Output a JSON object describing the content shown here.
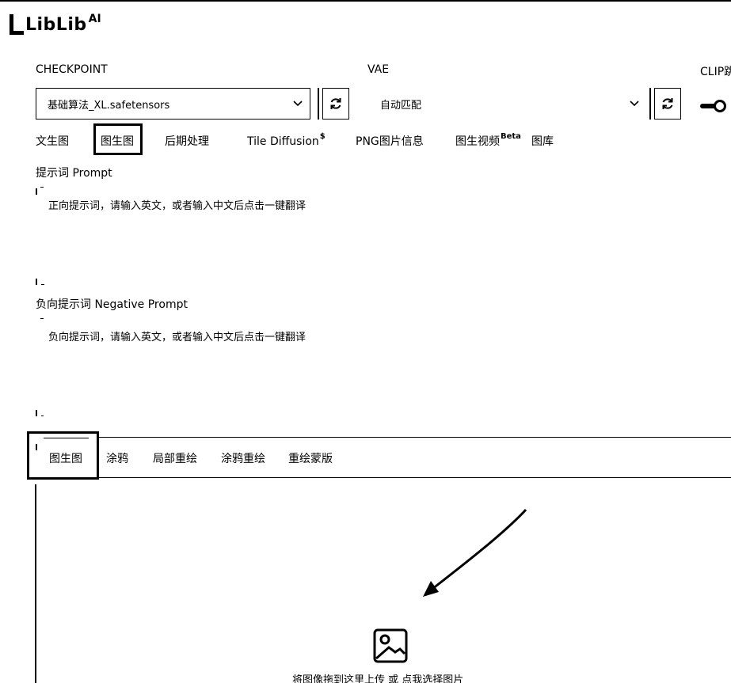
{
  "logo": {
    "text": "LibLib",
    "sup": "AI"
  },
  "checkpoint": {
    "label": "CHECKPOINT",
    "value": "基础算法_XL.safetensors"
  },
  "vae": {
    "label": "VAE",
    "value": "自动匹配"
  },
  "clip": {
    "label": "CLIP跳"
  },
  "icons": {
    "refresh": "refresh-icon",
    "chevron": "chevron-down-icon",
    "upload": "image-upload-icon"
  },
  "main_tabs": [
    {
      "label": "文生图"
    },
    {
      "label": "图生图",
      "active": true
    },
    {
      "label": "后期处理"
    },
    {
      "label": "Tile Diffusion",
      "sup": "$"
    },
    {
      "label": "PNG图片信息"
    },
    {
      "label": "图生视频",
      "sup": "Beta"
    },
    {
      "label": "图库"
    }
  ],
  "prompt": {
    "label": "提示词  Prompt",
    "placeholder": "正向提示词，请输入英文，或者输入中文后点击一键翻译"
  },
  "negative_prompt": {
    "label": "负向提示词  Negative Prompt",
    "placeholder": "负向提示词，请输入英文，或者输入中文后点击一键翻译"
  },
  "sub_tabs": [
    {
      "label": "图生图",
      "active": true
    },
    {
      "label": "涂鸦"
    },
    {
      "label": "局部重绘"
    },
    {
      "label": "涂鸦重绘"
    },
    {
      "label": "重绘蒙版"
    }
  ],
  "upload": {
    "text": "将图像拖到这里上传 或 点我选择图片"
  }
}
